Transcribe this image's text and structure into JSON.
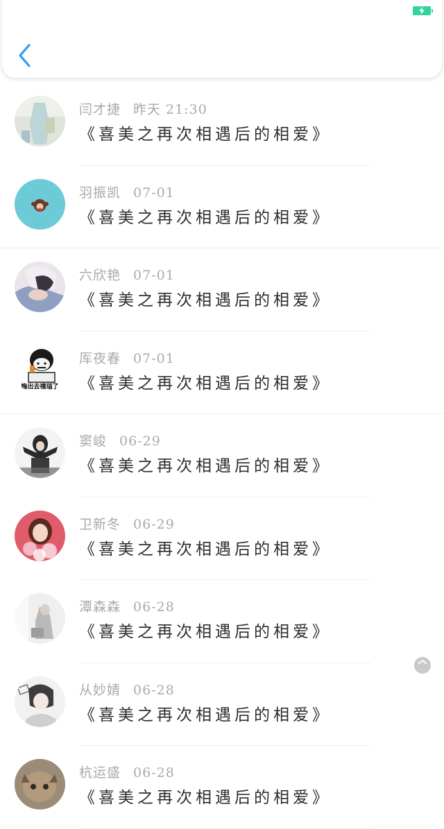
{
  "status_bar": {
    "battery_color": "#33d39c"
  },
  "header": {
    "back_icon": "chevron-left-icon",
    "accent": "#2f9cf0"
  },
  "items": [
    {
      "name": "闫才捷",
      "time": "昨天 21:30",
      "title": "《喜美之再次相遇后的相爱》"
    },
    {
      "name": "羽振凯",
      "time": "07-01",
      "title": "《喜美之再次相遇后的相爱》"
    },
    {
      "name": "六欣艳",
      "time": "07-01",
      "title": "《喜美之再次相遇后的相爱》"
    },
    {
      "name": "厍夜春",
      "time": "07-01",
      "title": "《喜美之再次相遇后的相爱》"
    },
    {
      "name": "窦峻",
      "time": "06-29",
      "title": "《喜美之再次相遇后的相爱》"
    },
    {
      "name": "卫新冬",
      "time": "06-29",
      "title": "《喜美之再次相遇后的相爱》"
    },
    {
      "name": "潭森森",
      "time": "06-28",
      "title": "《喜美之再次相遇后的相爱》"
    },
    {
      "name": "从妙婧",
      "time": "06-28",
      "title": "《喜美之再次相遇后的相爱》"
    },
    {
      "name": "杭运盛",
      "time": "06-28",
      "title": "《喜美之再次相遇后的相爱》"
    }
  ],
  "avatar_sticker_text": "悔出去禧瑞了"
}
